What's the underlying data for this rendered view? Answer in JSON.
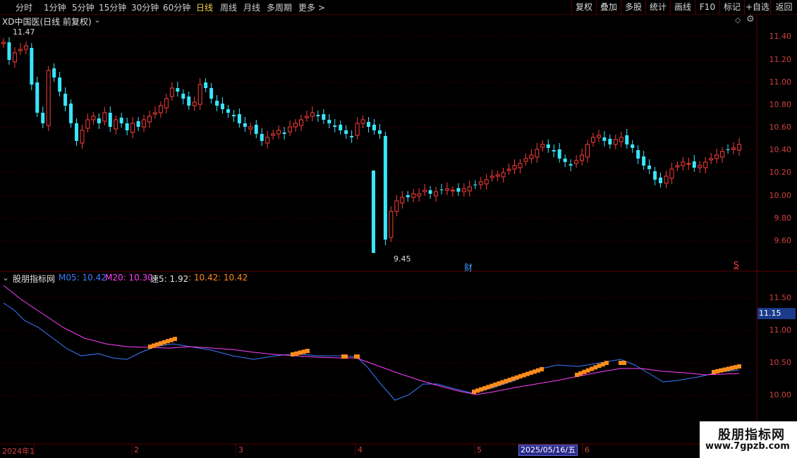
{
  "topbar": {
    "tabs": [
      {
        "id": "tab-fenshi",
        "label": "分时"
      },
      {
        "id": "tab-1min",
        "label": "1分钟"
      },
      {
        "id": "tab-5min",
        "label": "5分钟"
      },
      {
        "id": "tab-15min",
        "label": "15分钟"
      },
      {
        "id": "tab-30min",
        "label": "30分钟"
      },
      {
        "id": "tab-60min",
        "label": "60分钟"
      },
      {
        "id": "tab-daily",
        "label": "日线"
      },
      {
        "id": "tab-weekly",
        "label": "周线"
      },
      {
        "id": "tab-monthly",
        "label": "月线"
      },
      {
        "id": "tab-multi",
        "label": "多周期"
      },
      {
        "id": "tab-more",
        "label": "更多 >"
      }
    ],
    "active_tab": "日线",
    "buttons": [
      "复权",
      "叠加",
      "多股",
      "统计",
      "画线",
      "F10",
      "标记",
      "+自选",
      "返回"
    ]
  },
  "main_panel": {
    "title": "XD中国医(日线 前复权)",
    "high_marker": "11.47",
    "low_marker": "9.45",
    "fin_marker": "财",
    "s_marker": "S",
    "price_axis": [
      "11.40",
      "11.20",
      "11.00",
      "10.80",
      "10.60",
      "10.40",
      "10.20",
      "10.00",
      "9.80",
      "9.60"
    ]
  },
  "indicator_panel": {
    "name": "股朋指标网",
    "m05_label": "M05: 10.42",
    "m20_label": "M20: 10.30",
    "speed_label": "速5: 1.92",
    "v1_label": ": 10.42",
    "v2_label": ": 10.42",
    "axis": [
      "11.50",
      "11.00",
      "10.50",
      "10.00"
    ],
    "current_value": "11.15"
  },
  "time_axis": {
    "labels": [
      "2024年1",
      "2",
      "3",
      "4",
      "5",
      "6"
    ],
    "cursor_date": "2025/05/16/五"
  },
  "watermark": {
    "title": "股朋指标网",
    "url": "www.7gpzb.com"
  },
  "colors": {
    "up": "#ff3c3c",
    "down": "#39e6ff",
    "m05": "#3b7bff",
    "m20": "#ff40ff",
    "dots": "#ff8c1a",
    "green_num": "#40d040",
    "yellow_num": "#f0c030",
    "grid": "#3a0000"
  }
}
